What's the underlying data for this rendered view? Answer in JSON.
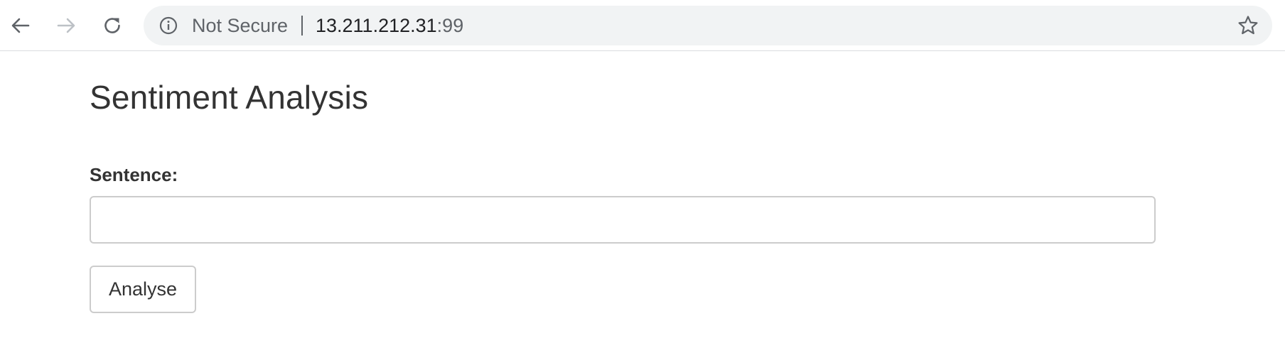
{
  "browser": {
    "security_label": "Not Secure",
    "url_host": "13.211.212.31",
    "url_port": ":99",
    "icons": {
      "back": "back-arrow-icon",
      "forward": "forward-arrow-icon",
      "reload": "reload-icon",
      "info": "info-icon",
      "bookmark": "star-icon"
    }
  },
  "page": {
    "title": "Sentiment Analysis",
    "form": {
      "sentence_label": "Sentence:",
      "sentence_value": "",
      "sentence_placeholder": "",
      "submit_label": "Analyse"
    }
  }
}
